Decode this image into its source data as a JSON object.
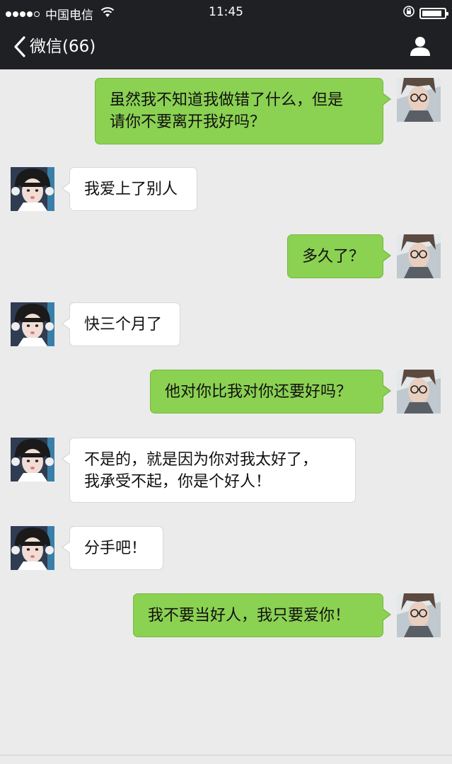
{
  "status_bar": {
    "carrier": "中国电信",
    "time": "11:45",
    "battery_level": 0.9
  },
  "nav": {
    "back_label": "微信(66)"
  },
  "colors": {
    "outgoing_bubble": "#8bd152",
    "incoming_bubble": "#ffffff",
    "chat_background": "#ebebeb",
    "navbar": "#1f2023"
  },
  "messages": [
    {
      "sender": "me",
      "text": "虽然我不知道我做错了什么，但是\n请你不要离开我好吗？"
    },
    {
      "sender": "other",
      "text": "我爱上了别人"
    },
    {
      "sender": "me",
      "text": "多久了？"
    },
    {
      "sender": "other",
      "text": "快三个月了"
    },
    {
      "sender": "me",
      "text": "他对你比我对你还要好吗？"
    },
    {
      "sender": "other",
      "text": "不是的，就是因为你对我太好了，\n我承受不起，你是个好人！"
    },
    {
      "sender": "other",
      "text": "分手吧！"
    },
    {
      "sender": "me",
      "text": "我不要当好人，我只要爱你！"
    }
  ]
}
